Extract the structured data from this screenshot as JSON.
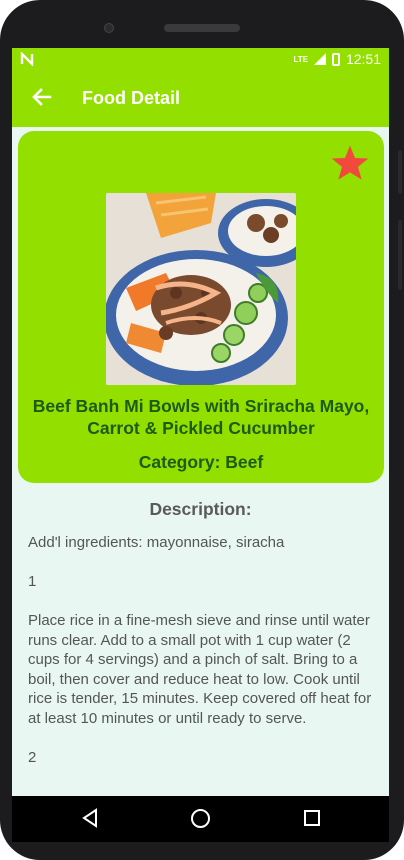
{
  "status_bar": {
    "time": "12:51",
    "network": "LTE",
    "left_icon": "n-icon"
  },
  "app_bar": {
    "title": "Food Detail",
    "back_icon": "arrow-left-icon"
  },
  "food": {
    "title": "Beef Banh Mi Bowls with Sriracha Mayo, Carrot & Pickled Cucumber",
    "category": "Category: Beef",
    "favorite_icon": "star-icon",
    "favorite_color": "#f14a3c"
  },
  "description": {
    "heading": "Description:",
    "text": "Add'l ingredients: mayonnaise, siracha\n\n1\n\nPlace rice in a fine-mesh sieve and rinse until water runs clear. Add to a small pot with 1 cup water (2 cups for 4 servings) and a pinch of salt. Bring to a boil, then cover and reduce heat to low. Cook until rice is tender, 15 minutes. Keep covered off heat for at least 10 minutes or until ready to serve.\n\n2"
  },
  "colors": {
    "accent": "#93e000",
    "screen_bg": "#e8f7f1",
    "title_text": "#1e5b12"
  }
}
